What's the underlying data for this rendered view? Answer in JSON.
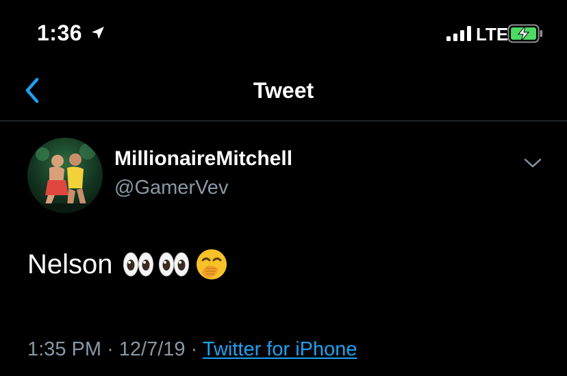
{
  "status_bar": {
    "time": "1:36",
    "network": "LTE",
    "icons": [
      "location-icon",
      "signal-icon",
      "battery-charging-icon"
    ]
  },
  "nav": {
    "title": "Tweet",
    "back_icon": "chevron-left-icon"
  },
  "tweet": {
    "author_name": "MillionaireMitchell",
    "author_handle": "@GamerVev",
    "text": "Nelson",
    "emojis": [
      "eyes-icon",
      "eyes-icon",
      "face-with-hand-over-mouth-icon"
    ],
    "time": "1:35 PM",
    "separator": "·",
    "date": "12/7/19",
    "source": "Twitter for iPhone"
  },
  "colors": {
    "background": "#000000",
    "text": "#ffffff",
    "secondary": "#8899a6",
    "accent": "#1da1f2",
    "divider": "#38444d",
    "battery": "#4cd964"
  }
}
